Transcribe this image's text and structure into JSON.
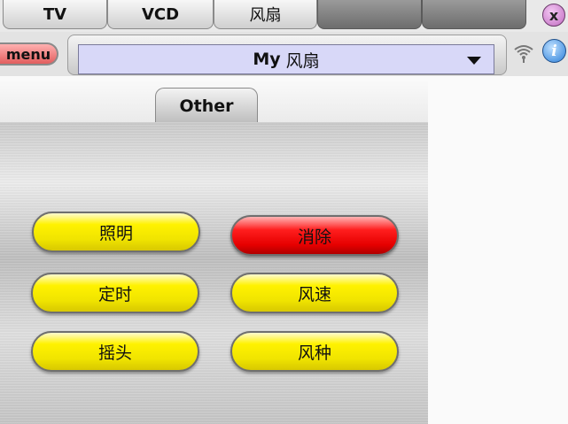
{
  "device_tabs": [
    {
      "label": "TV"
    },
    {
      "label": "VCD"
    },
    {
      "label": "风扇"
    },
    {
      "label": ""
    },
    {
      "label": ""
    }
  ],
  "close_glyph": "x",
  "menu_label": "menu",
  "device_select": {
    "prefix": "My",
    "name": "风扇"
  },
  "info_glyph": "i",
  "page_tab": "Other",
  "buttons": [
    {
      "label": "照明",
      "color": "#ffff00"
    },
    {
      "label": "消除",
      "color": "#ff0000"
    },
    {
      "label": "定时",
      "color": "#ffff00"
    },
    {
      "label": "风速",
      "color": "#ffff00"
    },
    {
      "label": "摇头",
      "color": "#ffff00"
    },
    {
      "label": "风种",
      "color": "#ffff00"
    }
  ],
  "icons": {
    "close": "close-icon",
    "dropdown": "chevron-down-icon",
    "wifi": "wifi-icon",
    "info": "info-icon"
  }
}
